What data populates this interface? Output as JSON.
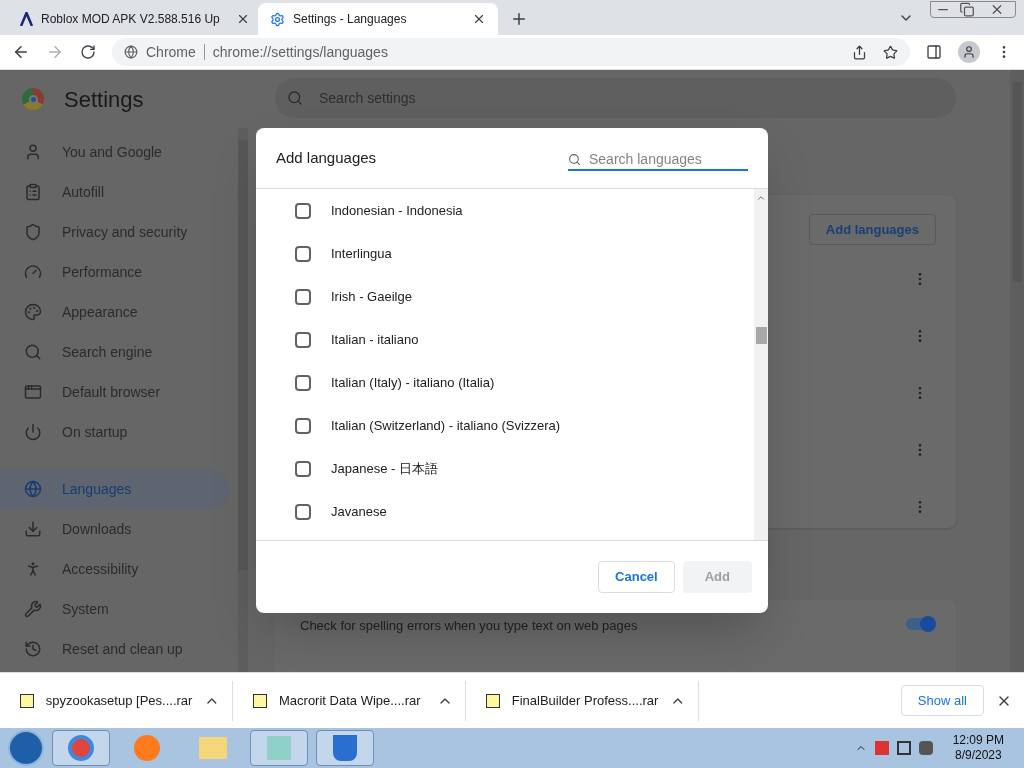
{
  "browser": {
    "tabs": [
      {
        "title": "Roblox MOD APK V2.588.516 Up",
        "selected": false
      },
      {
        "title": "Settings - Languages",
        "selected": true
      }
    ],
    "site_label": "Chrome",
    "url": "chrome://settings/languages"
  },
  "settings": {
    "title": "Settings",
    "search": {
      "placeholder": "Search settings"
    },
    "sidebar": [
      {
        "label": "You and Google",
        "selected": false
      },
      {
        "label": "Autofill",
        "selected": false
      },
      {
        "label": "Privacy and security",
        "selected": false
      },
      {
        "label": "Performance",
        "selected": false
      },
      {
        "label": "Appearance",
        "selected": false
      },
      {
        "label": "Search engine",
        "selected": false
      },
      {
        "label": "Default browser",
        "selected": false
      },
      {
        "label": "On startup",
        "selected": false
      },
      {
        "label": "Languages",
        "selected": true
      },
      {
        "label": "Downloads",
        "selected": false
      },
      {
        "label": "Accessibility",
        "selected": false
      },
      {
        "label": "System",
        "selected": false
      },
      {
        "label": "Reset and clean up",
        "selected": false
      }
    ],
    "add_languages_button": "Add languages",
    "spell_check": {
      "label": "Check for spelling errors when you type text on web pages",
      "on": true
    }
  },
  "dialog": {
    "title": "Add languages",
    "search": {
      "placeholder": "Search languages"
    },
    "languages": [
      {
        "label": "Indonesian - Indonesia",
        "checked": false
      },
      {
        "label": "Interlingua",
        "checked": false
      },
      {
        "label": "Irish - Gaeilge",
        "checked": false
      },
      {
        "label": "Italian - italiano",
        "checked": false
      },
      {
        "label": "Italian (Italy) - italiano (Italia)",
        "checked": false
      },
      {
        "label": "Italian (Switzerland) - italiano (Svizzera)",
        "checked": false
      },
      {
        "label": "Japanese - 日本語",
        "checked": false
      },
      {
        "label": "Javanese",
        "checked": false
      }
    ],
    "buttons": [
      {
        "label": "Cancel",
        "disabled": false
      },
      {
        "label": "Add",
        "disabled": true
      }
    ]
  },
  "downloads": {
    "items": [
      "spyzookasetup [Pes....rar",
      "Macrorit Data Wipe....rar",
      "FinalBuilder Profess....rar"
    ],
    "show_all": "Show all"
  },
  "taskbar": {
    "time": "12:09 PM",
    "date": "8/9/2023"
  }
}
